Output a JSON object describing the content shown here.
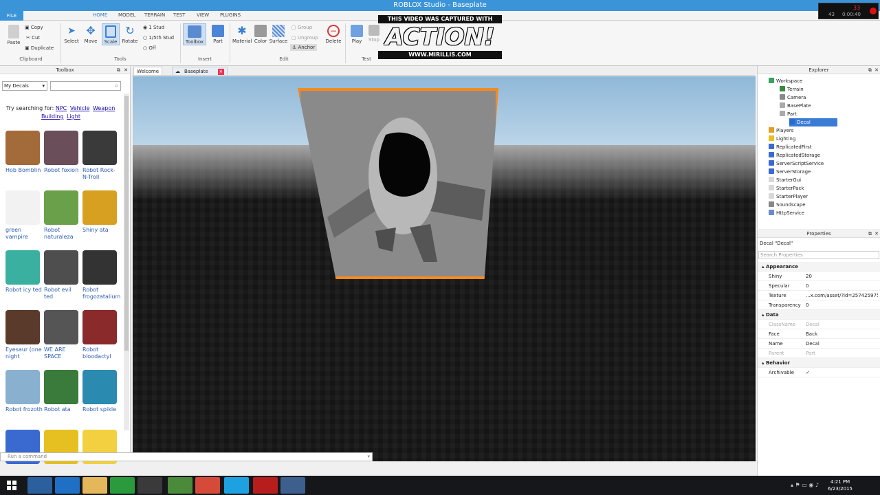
{
  "title": "ROBLOX Studio - Baseplate",
  "menu": {
    "file": "FILE",
    "tabs": [
      "HOME",
      "MODEL",
      "TERRAIN",
      "TEST",
      "VIEW",
      "PLUGINS"
    ]
  },
  "ribbon": {
    "paste": "Paste",
    "copy": "Copy",
    "cut": "Cut",
    "duplicate": "Duplicate",
    "clipboard": "Clipboard",
    "select": "Select",
    "move": "Move",
    "scale": "Scale",
    "rotate": "Rotate",
    "tools": "Tools",
    "snap": [
      "1 Stud",
      "1/5th Stud",
      "Off"
    ],
    "toolbox": "Toolbox",
    "part": "Part",
    "insert": "Insert",
    "material": "Material",
    "color": "Color",
    "surface": "Surface",
    "group": "Group",
    "ungroup": "Ungroup",
    "anchor": "Anchor",
    "delete": "Delete",
    "edit": "Edit",
    "play": "Play",
    "stop": "Stop",
    "test": "Test"
  },
  "overlay": {
    "caption": "THIS VIDEO WAS CAPTURED WITH",
    "logo": "ACTION!",
    "url": "WWW.MIRILLIS.COM"
  },
  "recorder": {
    "fps": "33",
    "time": "0:00:40",
    "lbl": "43"
  },
  "toolbox": {
    "title": "Toolbox",
    "category": "My Decals",
    "try_label": "Try searching for:",
    "suggestions": [
      "NPC",
      "Vehicle",
      "Weapon",
      "Building",
      "Light"
    ],
    "items": [
      "Hob Bomblin",
      "Robot foxion",
      "Robot Rock-N-Troll",
      "green vampire",
      "Robot naturaleza",
      "Shiny ata",
      "Robot icy ted",
      "Robot evil ted",
      "Robot frogozatalium",
      "Eyesaur (one night",
      "WE ARE SPACE",
      "Robot bloodactyl",
      "Robot frozoth",
      "Robot ata",
      "Robot spikle",
      "",
      "",
      ""
    ]
  },
  "tabs": [
    "Welcome",
    "Baseplate"
  ],
  "command_placeholder": "Run a command",
  "explorer": {
    "title": "Explorer",
    "nodes": [
      "Workspace",
      "Terrain",
      "Camera",
      "BasePlate",
      "Part",
      "Decal",
      "Players",
      "Lighting",
      "ReplicatedFirst",
      "ReplicatedStorage",
      "ServerScriptService",
      "ServerStorage",
      "StarterGui",
      "StarterPack",
      "StarterPlayer",
      "Soundscape",
      "HttpService"
    ]
  },
  "properties": {
    "title": "Properties",
    "object": "Decal \"Decal\"",
    "search": "Search Properties",
    "rows": [
      {
        "n": "Appearance",
        "v": ""
      },
      {
        "n": "Shiny",
        "v": "20"
      },
      {
        "n": "Specular",
        "v": "0"
      },
      {
        "n": "Texture",
        "v": "...x.com/asset/?id=257425975"
      },
      {
        "n": "Transparency",
        "v": "0"
      },
      {
        "n": "Data",
        "v": ""
      },
      {
        "n": "ClassName",
        "v": "Decal"
      },
      {
        "n": "Face",
        "v": "Back"
      },
      {
        "n": "Name",
        "v": "Decal"
      },
      {
        "n": "Parent",
        "v": "Part"
      },
      {
        "n": "Behavior",
        "v": ""
      },
      {
        "n": "Archivable",
        "v": "✓"
      }
    ]
  },
  "clock": {
    "time": "4:21 PM",
    "date": "6/23/2015"
  },
  "colors": {
    "accent": "#3b94d8",
    "selection": "#f58a1f"
  }
}
